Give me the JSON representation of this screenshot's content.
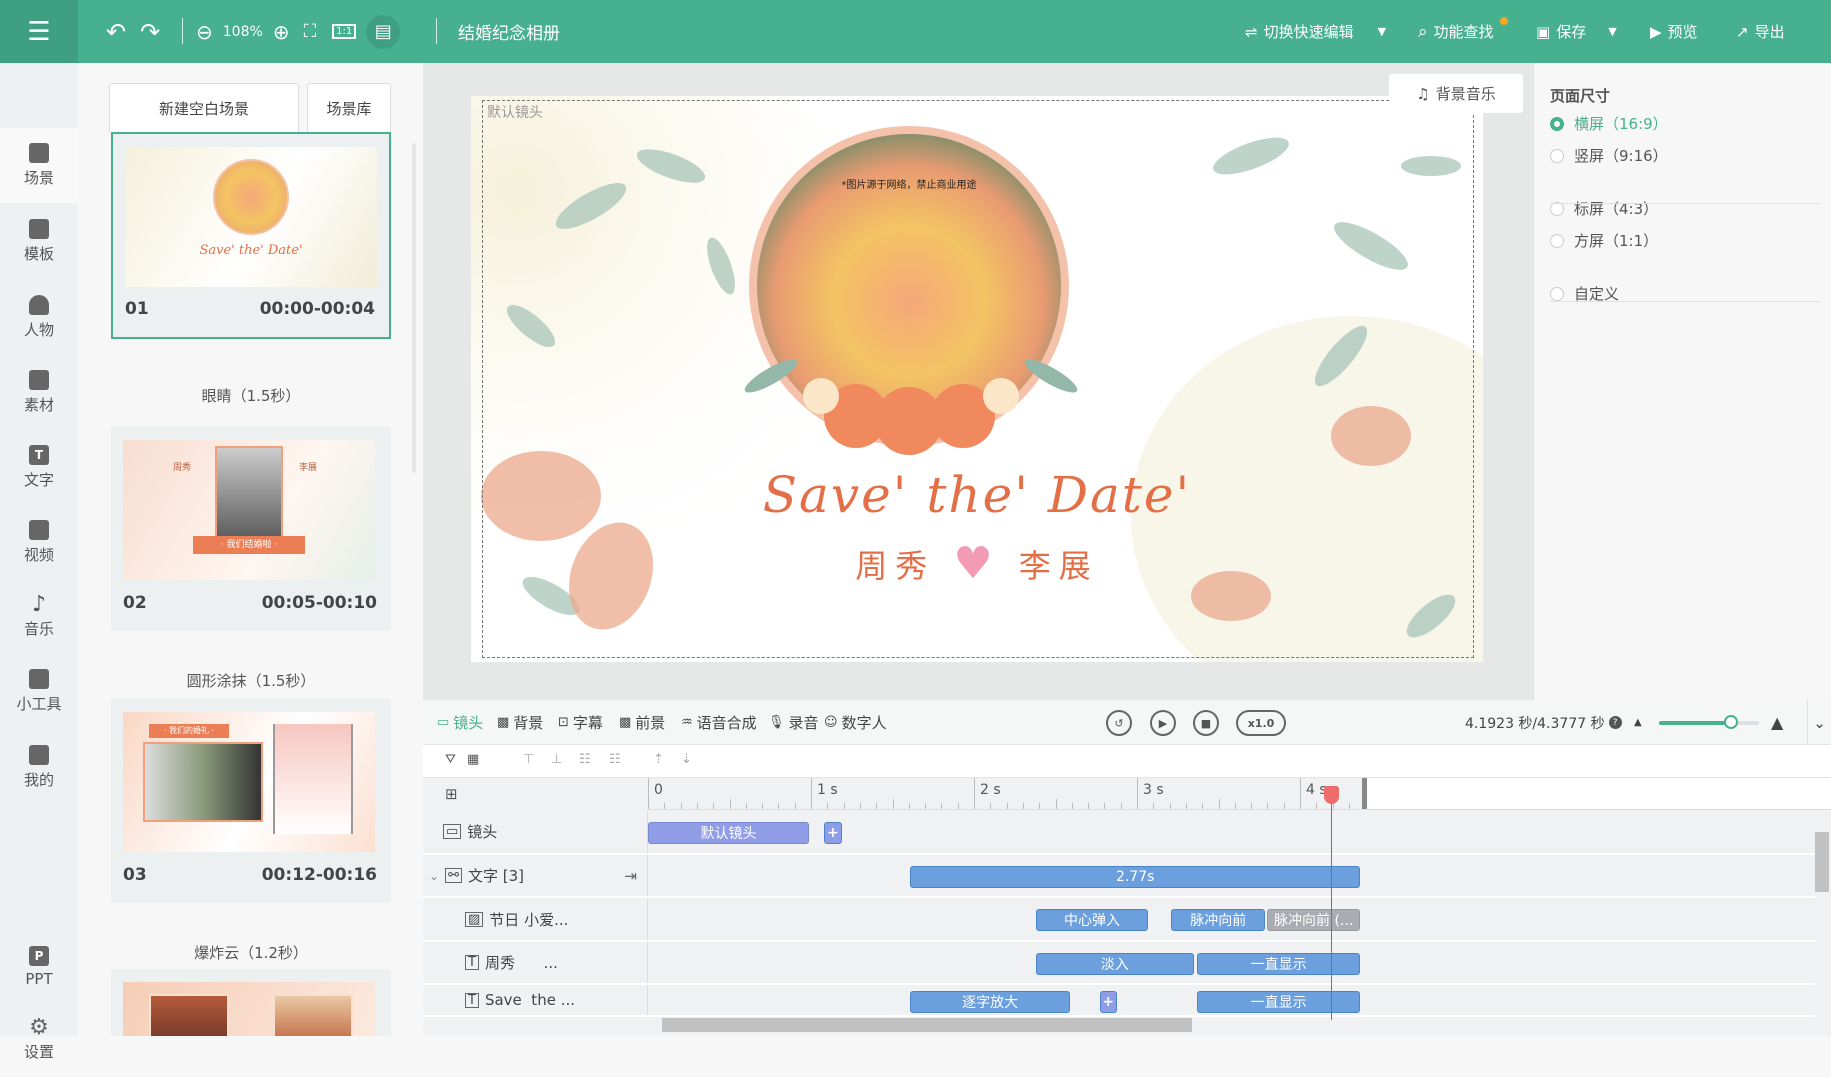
{
  "colors": {
    "accent": "#47b08f",
    "segment": "#6b9fdd",
    "camera_segment": "#8f9de6",
    "playhead": "#e04848",
    "gray_segment": "#a9acb1"
  },
  "topbar": {
    "menu_icon": "hamburger-icon",
    "zoom": "108%",
    "title": "结婚纪念相册",
    "switch_label": "切换快速编辑",
    "search_label": "功能查找",
    "save_label": "保存",
    "preview_label": "预览",
    "export_label": "导出"
  },
  "rail": [
    {
      "label": "场景",
      "icon": "scene-icon"
    },
    {
      "label": "模板",
      "icon": "template-icon"
    },
    {
      "label": "人物",
      "icon": "person-icon"
    },
    {
      "label": "素材",
      "icon": "material-icon"
    },
    {
      "label": "文字",
      "icon": "text-icon"
    },
    {
      "label": "视频",
      "icon": "video-icon"
    },
    {
      "label": "音乐",
      "icon": "music-icon"
    },
    {
      "label": "小工具",
      "icon": "toolbox-icon"
    },
    {
      "label": "我的",
      "icon": "upload-icon"
    },
    {
      "label": "PPT",
      "icon": "ppt-icon"
    },
    {
      "label": "设置",
      "icon": "gear-icon"
    }
  ],
  "scenes": {
    "new_button": "新建空白场景",
    "library_button": "场景库",
    "items": [
      {
        "num": "01",
        "time": "00:00-00:04",
        "transition": "眼睛（1.5秒）"
      },
      {
        "num": "02",
        "time": "00:05-00:10",
        "transition": "圆形涂抹（1.5秒）"
      },
      {
        "num": "03",
        "time": "00:12-00:16",
        "transition": "爆炸云（1.2秒）"
      }
    ]
  },
  "canvas": {
    "camera_label": "默认镜头",
    "bgm_button": "背景音乐",
    "notice": "*图片源于网络，禁止商业用途",
    "headline": "Save' the' Date'",
    "name_left": "周秀",
    "name_right": "李展",
    "thumb2_left": "周秀",
    "thumb2_right": "李展",
    "thumb2_banner": "· 我们结婚啦 ·",
    "thumb3_banner": "· 我们的婚礼 ·"
  },
  "page_size": {
    "title": "页面尺寸",
    "options": [
      {
        "label": "横屏（16:9）",
        "selected": true
      },
      {
        "label": "竖屏（9:16）",
        "selected": false
      },
      {
        "label": "标屏（4:3）",
        "selected": false
      },
      {
        "label": "方屏（1:1）",
        "selected": false
      },
      {
        "label": "自定义",
        "selected": false
      }
    ]
  },
  "timeline": {
    "tabs": [
      "镜头",
      "背景",
      "字幕",
      "前景",
      "语音合成",
      "录音",
      "数字人"
    ],
    "speed": "x1.0",
    "time_readout": "4.1923 秒/4.3777 秒",
    "zoom_level": 0.72,
    "playhead_s": 4.1923,
    "total_s": 4.3777,
    "ticks": [
      "0",
      "1 s",
      "2 s",
      "3 s",
      "4 s"
    ],
    "rows": [
      {
        "label": "镜头",
        "icon": "camera-icon",
        "segments": [
          {
            "text": "默认镜头",
            "start": 0,
            "end": 1,
            "kind": "camera"
          },
          {
            "text": "+",
            "start": 1.08,
            "end": 1.2,
            "kind": "add"
          }
        ]
      },
      {
        "label": "文字 [3]",
        "icon": "text-group-icon",
        "segments": [
          {
            "text": "2.77s",
            "start": 1.61,
            "end": 4.38,
            "kind": "normal"
          }
        ]
      },
      {
        "label": "节日 小爱...",
        "icon": "image-text-icon",
        "segments": [
          {
            "text": "中心弹入",
            "start": 2.38,
            "end": 3.08,
            "kind": "normal"
          },
          {
            "text": "脉冲向前",
            "start": 3.21,
            "end": 3.8,
            "kind": "normal"
          },
          {
            "text": "脉冲向前 (...",
            "start": 3.8,
            "end": 4.38,
            "kind": "gray"
          }
        ]
      },
      {
        "label": "周秀      ...",
        "icon": "text-icon",
        "segments": [
          {
            "text": "淡入",
            "start": 2.38,
            "end": 3.36,
            "kind": "normal"
          },
          {
            "text": "一直显示",
            "start": 3.37,
            "end": 4.38,
            "kind": "normal"
          }
        ]
      },
      {
        "label": "Save  the ...",
        "icon": "text-icon",
        "segments": [
          {
            "text": "逐字放大",
            "start": 1.61,
            "end": 2.6,
            "kind": "normal"
          },
          {
            "text": "+",
            "start": 2.77,
            "end": 2.89,
            "kind": "add"
          },
          {
            "text": "一直显示",
            "start": 3.37,
            "end": 4.38,
            "kind": "normal"
          }
        ]
      }
    ]
  }
}
